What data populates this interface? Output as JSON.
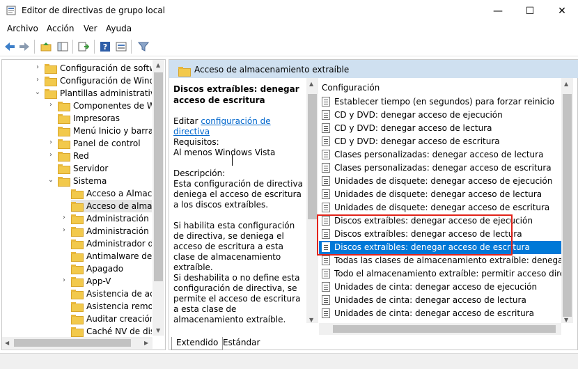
{
  "window": {
    "title": "Editor de directivas de grupo local",
    "minimize_glyph": "—",
    "maximize_glyph": "☐",
    "close_glyph": "✕"
  },
  "menu": [
    "Archivo",
    "Acción",
    "Ver",
    "Ayuda"
  ],
  "toolbar": {
    "icons": [
      "back-icon",
      "forward-icon",
      "up-folder-icon",
      "show-hide-tree-icon",
      "export-list-icon",
      "help-icon",
      "properties-icon",
      "filter-icon"
    ]
  },
  "tree": {
    "items": [
      {
        "label": "Configuración de software",
        "expander": "›"
      },
      {
        "label": "Configuración de Windows",
        "expander": "›"
      },
      {
        "label": "Plantillas administrativas",
        "expander": "⌄"
      },
      {
        "label": "Componentes de Window",
        "expander": "›"
      },
      {
        "label": "Impresoras",
        "expander": ""
      },
      {
        "label": "Menú Inicio y barra de tar",
        "expander": ""
      },
      {
        "label": "Panel de control",
        "expander": "›"
      },
      {
        "label": "Red",
        "expander": "›"
      },
      {
        "label": "Servidor",
        "expander": ""
      },
      {
        "label": "Sistema",
        "expander": "⌄"
      },
      {
        "label": "Acceso a Almacenam",
        "expander": ""
      },
      {
        "label": "Acceso de almacenan",
        "expander": ""
      },
      {
        "label": "Administración de co",
        "expander": "›"
      },
      {
        "label": "Administración de en",
        "expander": "›"
      },
      {
        "label": "Administrador del ser",
        "expander": ""
      },
      {
        "label": "Antimalware de inicio",
        "expander": ""
      },
      {
        "label": "Apagado",
        "expander": ""
      },
      {
        "label": "App-V",
        "expander": "›"
      },
      {
        "label": "Asistencia de acceso o",
        "expander": ""
      },
      {
        "label": "Asistencia remota",
        "expander": ""
      },
      {
        "label": "Auditar creación de p",
        "expander": ""
      },
      {
        "label": "Caché NV de disco",
        "expander": ""
      }
    ]
  },
  "header": {
    "title": "Acceso de almacenamiento extraíble"
  },
  "description": {
    "title": "Discos extraíbles: denegar acceso de escritura",
    "edit_prefix": "Editar ",
    "edit_link": "configuración de directiva",
    "requirements_label": "Requisitos:",
    "requirements_value": "Al menos Windows Vista",
    "description_label": "Descripción:",
    "p1": "Esta configuración de directiva deniega el acceso de escritura a los discos extraíbles.",
    "p2": "Si habilita esta configuración de directiva, se deniega el acceso de escritura a esta clase de almacenamiento extraíble.",
    "p3": "Si deshabilita o no define esta configuración de directiva, se permite el acceso de escritura a esta clase de almacenamiento extraíble."
  },
  "list": {
    "header": "Configuración",
    "items": [
      "Establecer tiempo (en segundos) para forzar reinicio",
      "CD y DVD: denegar acceso de ejecución",
      "CD y DVD: denegar acceso de lectura",
      "CD y DVD: denegar acceso de escritura",
      "Clases personalizadas: denegar acceso de lectura",
      "Clases personalizadas: denegar acceso de escritura",
      "Unidades de disquete: denegar acceso de ejecución",
      "Unidades de disquete: denegar acceso de lectura",
      "Unidades de disquete: denegar acceso de escritura",
      "Discos extraíbles: denegar acceso de ejecución",
      "Discos extraíbles: denegar acceso de lectura",
      "Discos extraíbles: denegar acceso de escritura",
      "Todas las clases de almacenamiento extraíble: denegar acce...",
      "Todo el almacenamiento extraíble: permitir acceso directo e...",
      "Unidades de cinta: denegar acceso de ejecución",
      "Unidades de cinta: denegar acceso de lectura",
      "Unidades de cinta: denegar acceso de escritura"
    ]
  },
  "tabs": [
    "Extendido",
    "Estándar"
  ],
  "colors": {
    "selection": "#0078d7",
    "header": "#cfe0f0",
    "highlight_box": "#e2231a"
  }
}
